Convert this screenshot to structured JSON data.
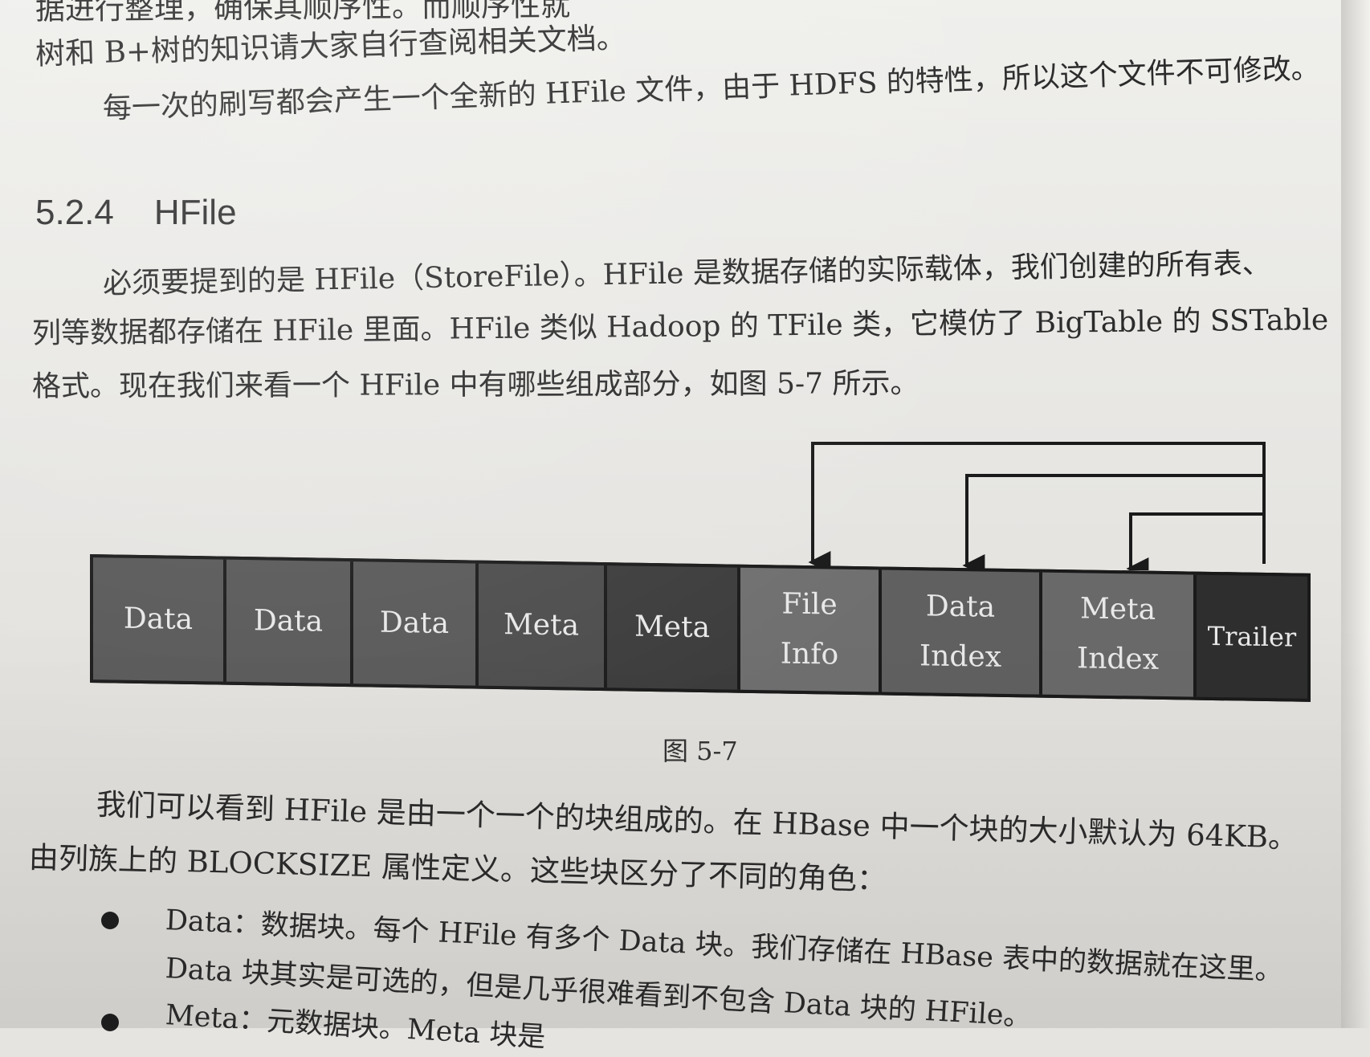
{
  "text": {
    "line_top_1": "据进行整理，确保其顺序性。而顺序性就",
    "line_top_2": "树和 B+树的知识请大家自行查阅相关文档。",
    "line_top_3": "每一次的刷写都会产生一个全新的 HFile 文件，由于 HDFS 的特性，所以这个文件不可修改。",
    "section_number": "5.2.4",
    "section_title": "HFile",
    "para1_line1": "必须要提到的是 HFile（StoreFile）。HFile 是数据存储的实际载体，我们创建的所有表、",
    "para1_line2": "列等数据都存储在 HFile 里面。HFile 类似 Hadoop 的 TFile 类，它模仿了 BigTable 的 SSTable",
    "para1_line3": "格式。现在我们来看一个 HFile 中有哪些组成部分，如图 5-7 所示。",
    "caption": "图 5-7",
    "para2_line1": "我们可以看到 HFile 是由一个一个的块组成的。在 HBase 中一个块的大小默认为 64KB。",
    "para2_line2": "由列族上的 BLOCKSIZE 属性定义。这些块区分了不同的角色：",
    "bullet1_line1": "Data：数据块。每个 HFile 有多个 Data 块。我们存储在 HBase 表中的数据就在这里。",
    "bullet1_line2": "Data 块其实是可选的，但是几乎很难看到不包含 Data 块的 HFile。",
    "bullet2_line1": "Meta：元数据块。Meta 块是"
  },
  "diagram": {
    "blocks": [
      {
        "line1": "Data",
        "line2": ""
      },
      {
        "line1": "Data",
        "line2": ""
      },
      {
        "line1": "Data",
        "line2": ""
      },
      {
        "line1": "Meta",
        "line2": ""
      },
      {
        "line1": "Meta",
        "line2": ""
      },
      {
        "line1": "File",
        "line2": "Info"
      },
      {
        "line1": "Data",
        "line2": "Index"
      },
      {
        "line1": "Meta",
        "line2": "Index"
      },
      {
        "line1": "Trailer",
        "line2": ""
      }
    ],
    "arrows_from": "Trailer",
    "arrows_to": [
      "File Info",
      "Data Index",
      "Meta Index"
    ]
  }
}
